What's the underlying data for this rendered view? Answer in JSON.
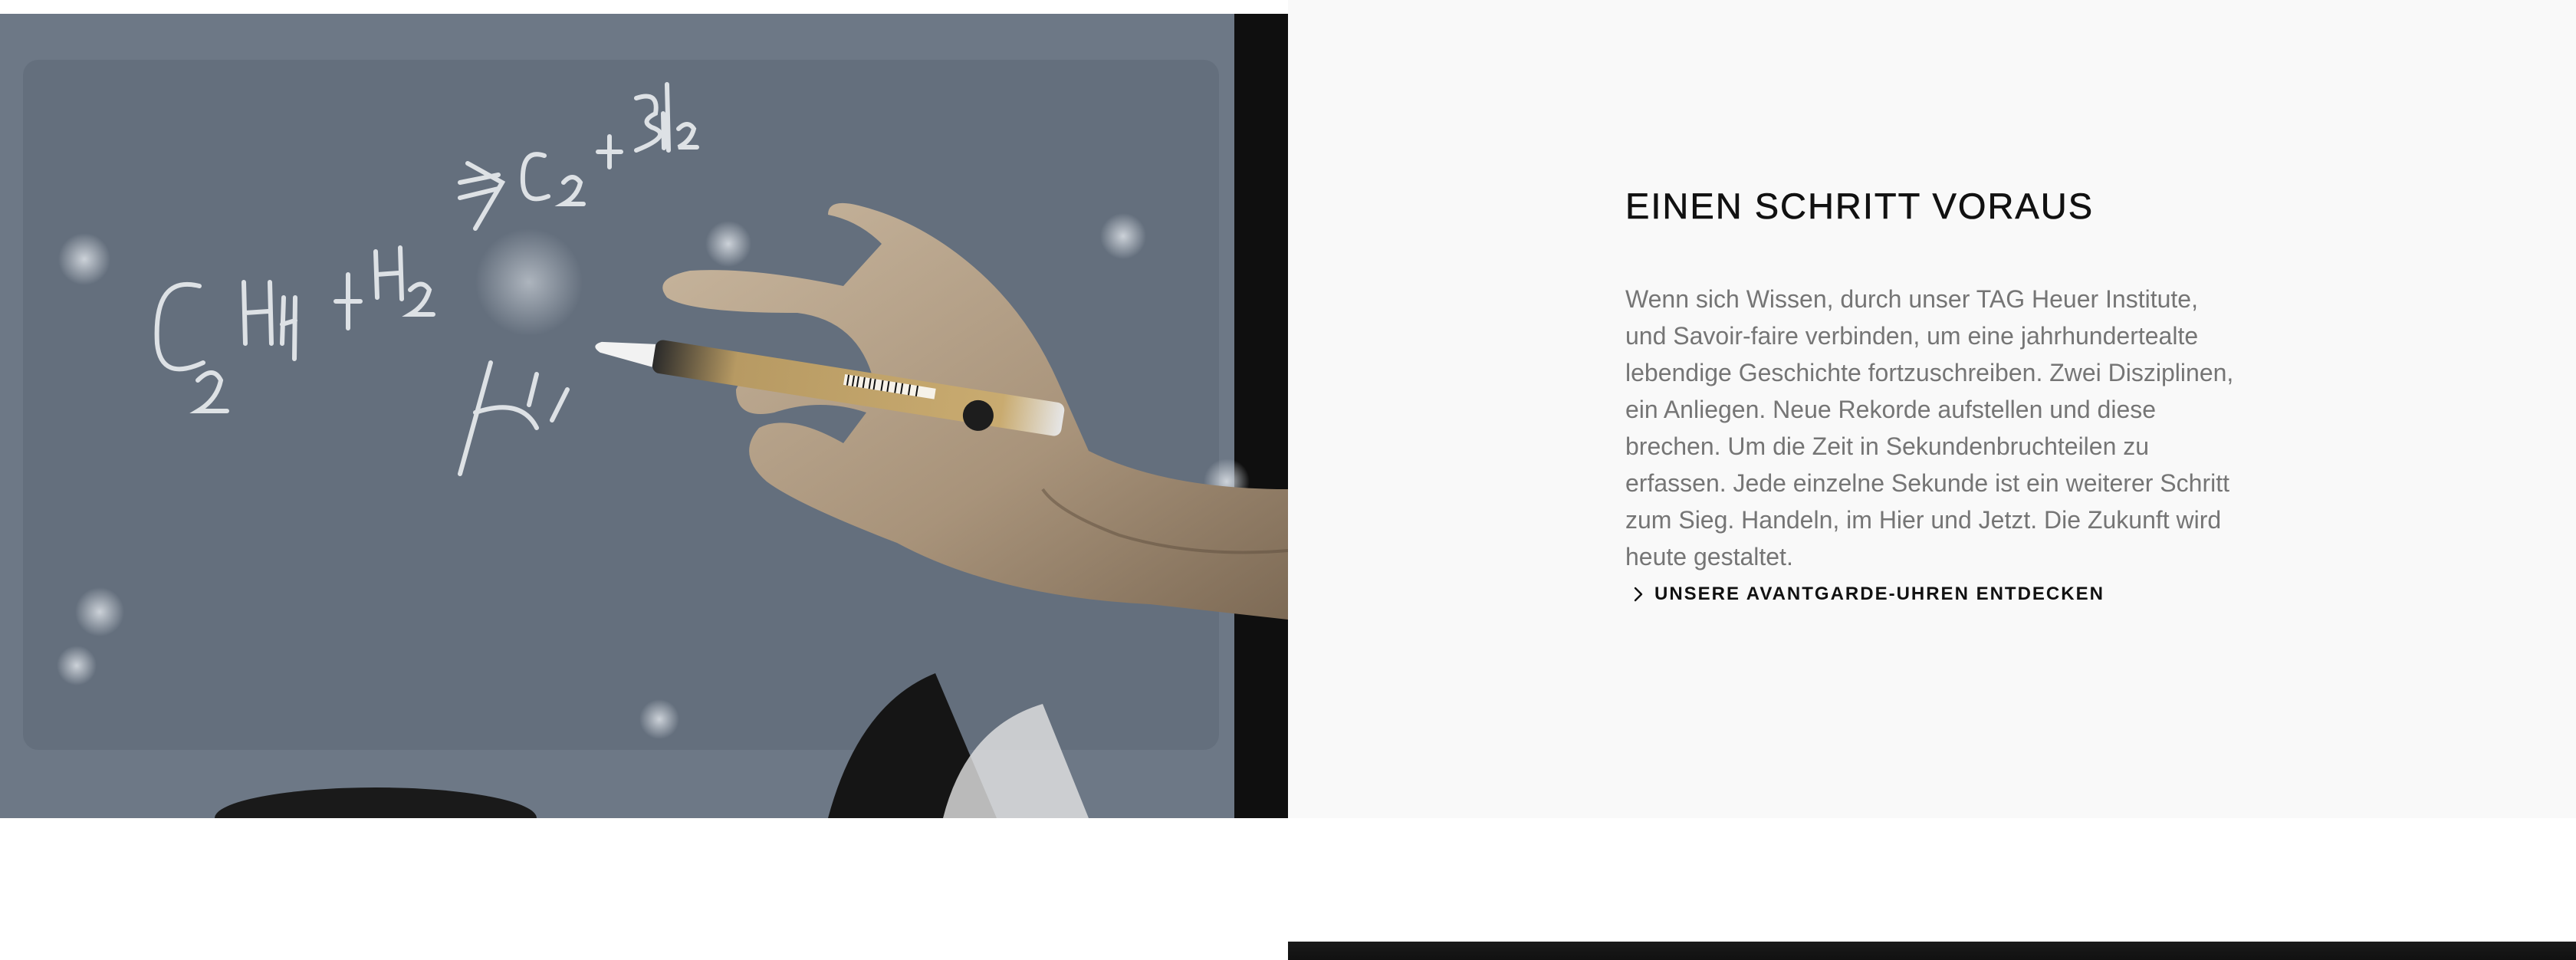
{
  "hero": {
    "image_alt": "Hand writing chemical formula on glass board",
    "formula_line1": "C2H4 + H2 ⇒ C2 + 3H2",
    "formula_line2": "Ir"
  },
  "section": {
    "heading": "EINEN SCHRITT VORAUS",
    "body": "Wenn sich Wissen, durch unser TAG Heuer Institute, und Savoir-faire verbinden, um eine jahrhundertealte lebendige Geschichte fortzuschreiben. Zwei Disziplinen, ein Anliegen. Neue Rekorde aufstellen und diese brechen. Um die Zeit in Sekundenbruchteilen zu erfassen. Jede einzelne Sekunde ist ein weiterer Schritt zum Sieg. Handeln, im Hier und Jetzt. Die Zukunft wird heute gestaltet.",
    "cta_label": "UNSERE AVANTGARDE-UHREN ENTDECKEN",
    "cta_icon": "chevron-right-icon"
  },
  "colors": {
    "panel_background": "#f9f9f9",
    "heading": "#111111",
    "body_text": "#757575"
  }
}
